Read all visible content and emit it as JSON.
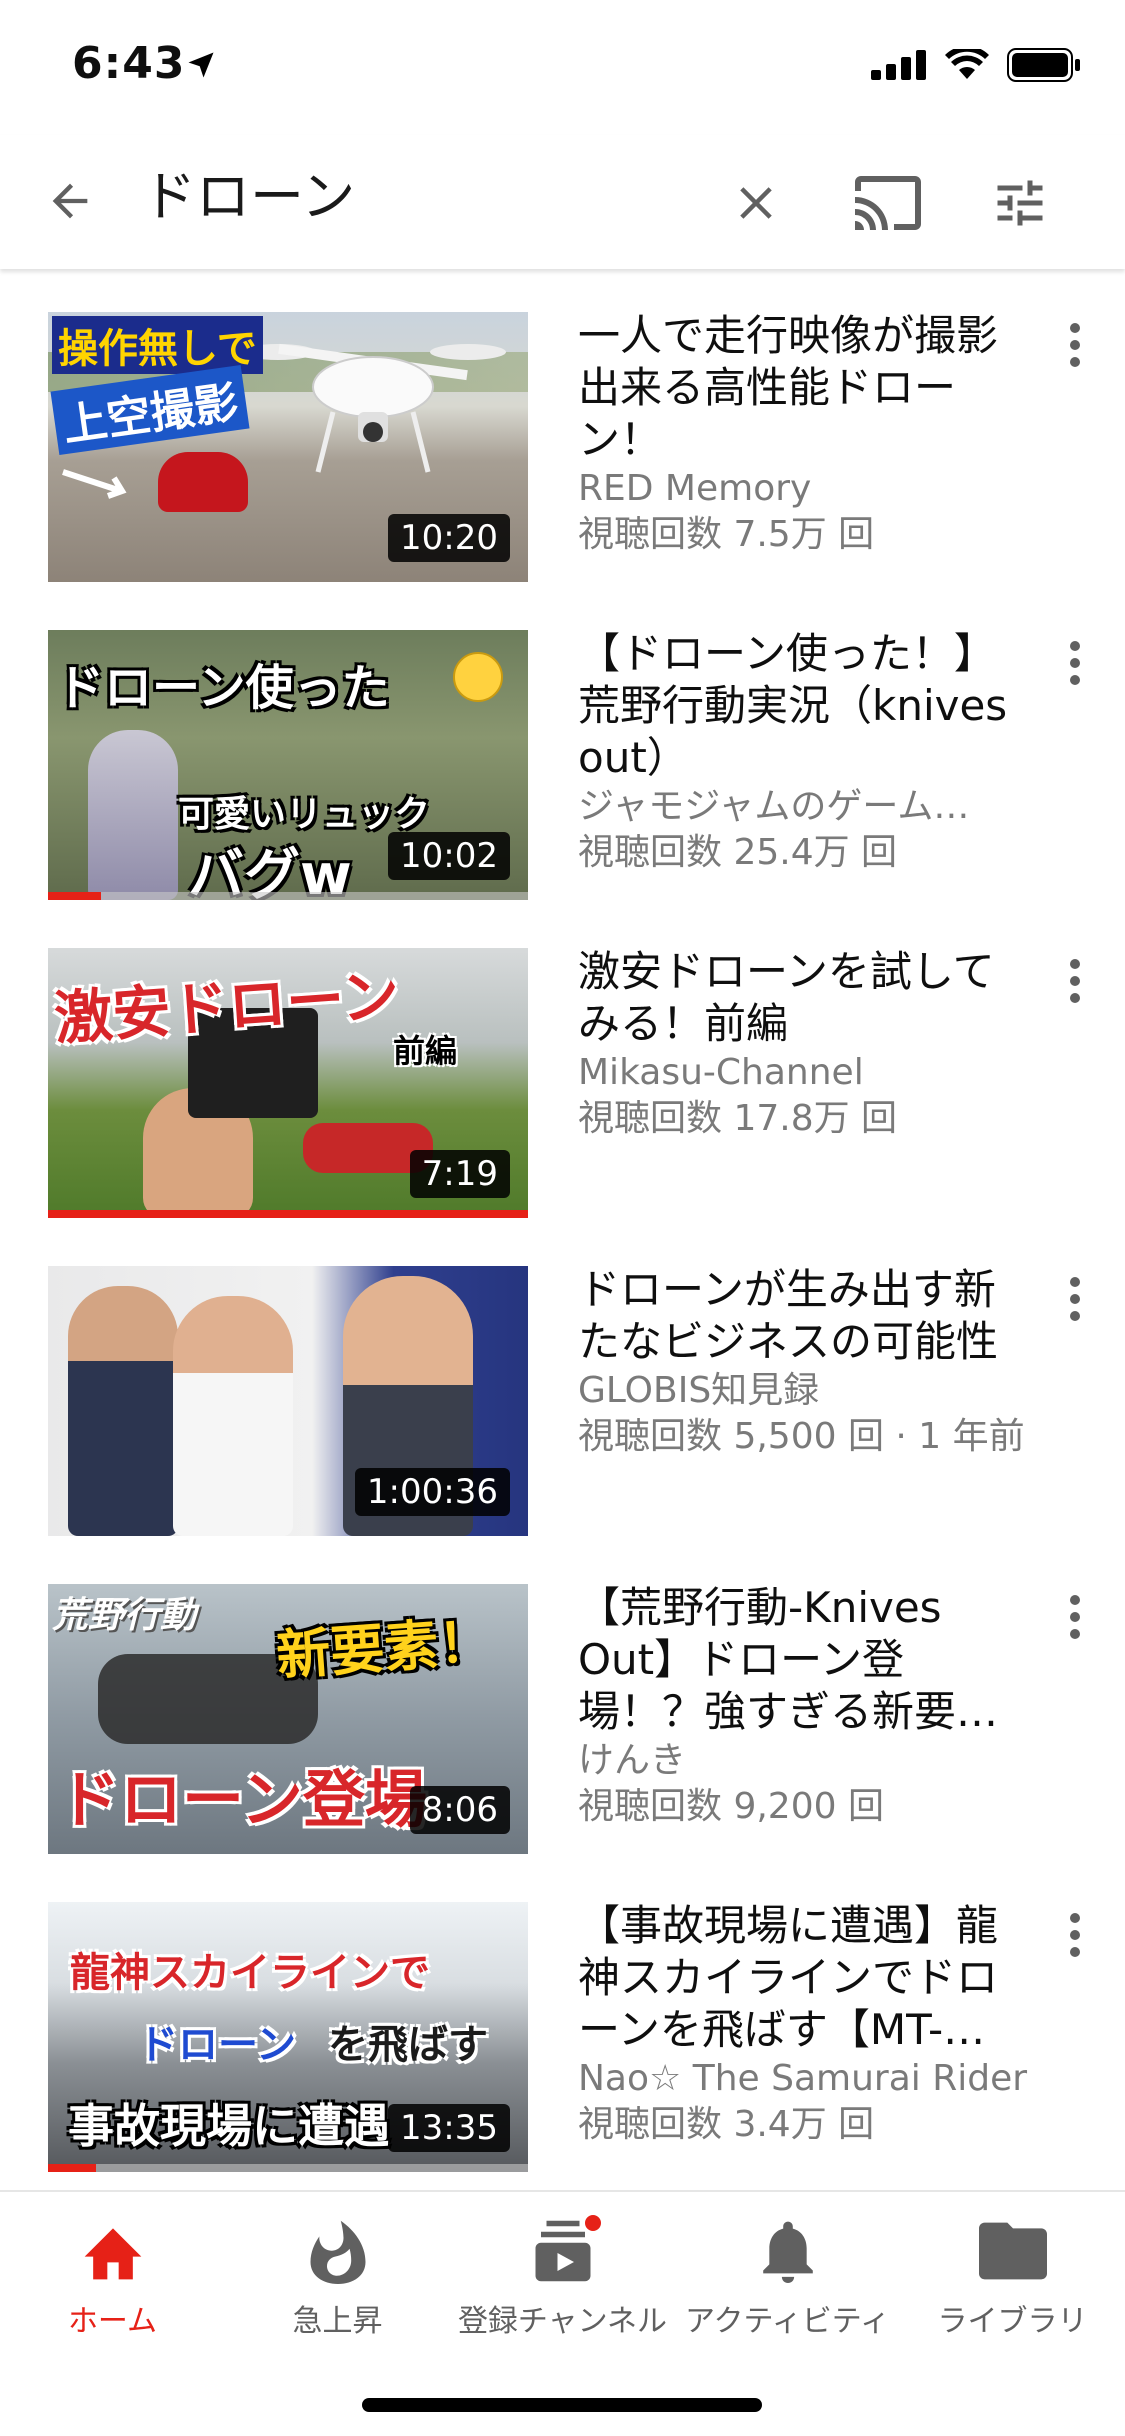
{
  "status_bar": {
    "time": "6:43"
  },
  "search": {
    "query": "ドローン"
  },
  "results": [
    {
      "title": "一人で走行映像が撮影出来る高性能ドローン！",
      "channel": "RED Memory",
      "views": "視聴回数 7.5万 回",
      "duration": "10:20",
      "thumb_texts": [
        "操作無しで",
        "上空撮影"
      ],
      "progress": 0
    },
    {
      "title": "【ドローン使った！】荒野行動実況（knives out）",
      "channel": "ジャモジャムのゲーム…",
      "views": "視聴回数 25.4万 回",
      "duration": "10:02",
      "thumb_texts": [
        "ドローン使った",
        "可愛いリュック",
        "バグw"
      ],
      "progress": 0.11
    },
    {
      "title": "激安ドローンを試してみる！前編",
      "channel": "Mikasu-Channel",
      "views": "視聴回数 17.8万 回",
      "duration": "7:19",
      "thumb_texts": [
        "激安ドローン",
        "前編"
      ],
      "progress": 1.0
    },
    {
      "title": "ドローンが生み出す新たなビジネスの可能性",
      "channel": "GLOBIS知見録",
      "views": "視聴回数 5,500 回 · 1 年前",
      "duration": "1:00:36",
      "thumb_texts": [],
      "progress": 0
    },
    {
      "title": "【荒野行動-Knives Out】ドローン登場！？強すぎる新要…",
      "channel": "けんき",
      "views": "視聴回数 9,200 回",
      "duration": "8:06",
      "thumb_texts": [
        "荒野行動",
        "新要素！",
        "ドローン登場"
      ],
      "progress": 0
    },
    {
      "title": "【事故現場に遭遇】龍神スカイラインでドローンを飛ばす【MT-…",
      "channel": "Nao☆ The Samurai Rider",
      "views": "視聴回数 3.4万 回",
      "duration": "13:35",
      "thumb_texts": [
        "龍神スカイラインで",
        "ドローン",
        "を飛ばす",
        "事故現場に遭遇"
      ],
      "progress": 0.1
    }
  ],
  "bottom_nav": [
    {
      "label": "ホーム",
      "icon": "home-icon",
      "active": true
    },
    {
      "label": "急上昇",
      "icon": "trending-flame-icon",
      "active": false
    },
    {
      "label": "登録チャンネル",
      "icon": "subscriptions-icon",
      "active": false
    },
    {
      "label": "アクティビティ",
      "icon": "bell-icon",
      "active": false
    },
    {
      "label": "ライブラリ",
      "icon": "folder-icon",
      "active": false
    }
  ],
  "colors": {
    "accent": "#e62117",
    "text_secondary": "#7a7a7a",
    "nav_inactive": "#606060"
  }
}
